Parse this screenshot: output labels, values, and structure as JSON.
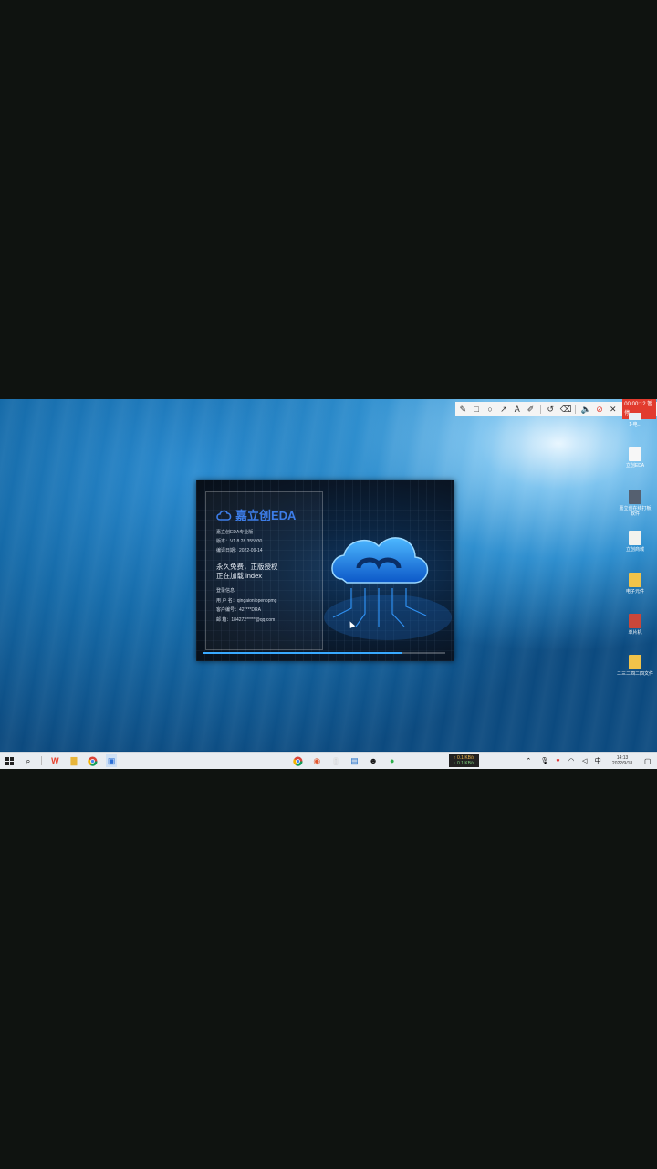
{
  "screen_recorder": {
    "timer": "00:00:12 暂停"
  },
  "desktop_icons": [
    {
      "label": "1-电..."
    },
    {
      "label": "立创EDA"
    },
    {
      "label": "嘉立创在线打板 软件"
    },
    {
      "label": "立创商城"
    },
    {
      "label": "电子元件"
    },
    {
      "label": "单片机"
    },
    {
      "label": "二三二四二四文件"
    }
  ],
  "splash": {
    "product_name": "嘉立创EDA",
    "edition": "嘉立创EDA专业版",
    "version": "版本：V1.8.28.355930",
    "build_date": "编译日期：2022-09-14",
    "license_line_1": "永久免费，正版授权",
    "license_line_2": "正在加载 index",
    "user_header": "登录信息",
    "username": "用 户 名：qingaioniopenopmg",
    "customer_id": "客户编号：42****DRA",
    "email": "邮    箱：184272*****@qq.com",
    "progress": 0.82
  },
  "taskbar": {
    "net_speed_up": "↑ 0.1 KB/s",
    "net_speed_down": "↓ 0.1 KB/s",
    "ime": "中",
    "time": "14:13",
    "date": "2022/9/18"
  },
  "colors": {
    "accent_blue": "#3d7de8",
    "progress": "#38a9ff",
    "recording_red": "#e23b2e"
  }
}
